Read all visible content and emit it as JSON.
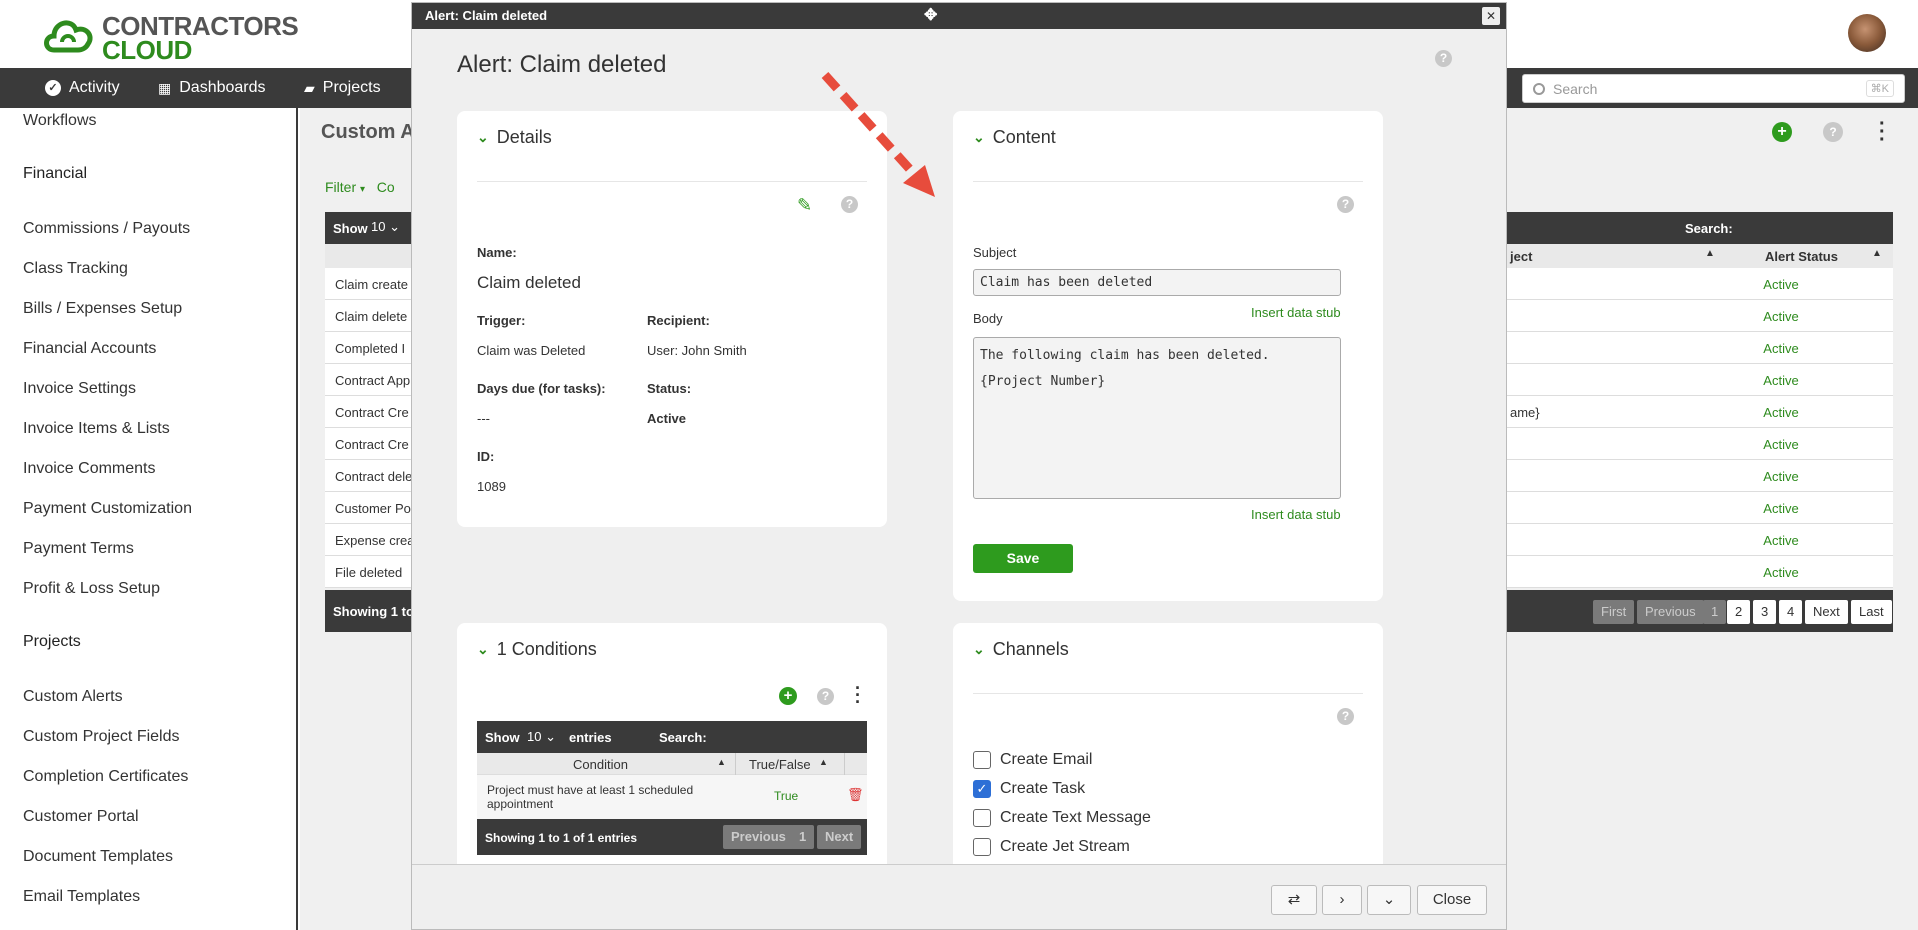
{
  "app": {
    "logo_line1": "CONTRACTORS",
    "logo_line2": "CLOUD",
    "nav": [
      "Activity",
      "Dashboards",
      "Projects"
    ],
    "search_placeholder": "Search",
    "search_shortcut": "⌘K"
  },
  "sidebar": {
    "items": [
      {
        "label": "Workflows",
        "heading": false
      },
      {
        "label": "Financial",
        "heading": true
      },
      {
        "label": "Commissions / Payouts",
        "heading": false
      },
      {
        "label": "Class Tracking",
        "heading": false
      },
      {
        "label": "Bills / Expenses Setup",
        "heading": false
      },
      {
        "label": "Financial Accounts",
        "heading": false
      },
      {
        "label": "Invoice Settings",
        "heading": false
      },
      {
        "label": "Invoice Items & Lists",
        "heading": false
      },
      {
        "label": "Invoice Comments",
        "heading": false
      },
      {
        "label": "Payment Customization",
        "heading": false
      },
      {
        "label": "Payment Terms",
        "heading": false
      },
      {
        "label": "Profit & Loss Setup",
        "heading": false
      },
      {
        "label": "Projects",
        "heading": true
      },
      {
        "label": "Custom Alerts",
        "heading": false
      },
      {
        "label": "Custom Project Fields",
        "heading": false
      },
      {
        "label": "Completion Certificates",
        "heading": false
      },
      {
        "label": "Customer Portal",
        "heading": false
      },
      {
        "label": "Document Templates",
        "heading": false
      },
      {
        "label": "Email Templates",
        "heading": false
      }
    ]
  },
  "background_page": {
    "title": "Custom A",
    "filter": "Filter",
    "filter2": "Co",
    "show_label": "Show",
    "show_value": "10",
    "search_label": "Search:",
    "col_project": "ject",
    "col_status": "Alert Status",
    "rows": [
      {
        "name": "Claim create",
        "extra": "",
        "status": "Active"
      },
      {
        "name": "Claim delete",
        "extra": "",
        "status": "Active"
      },
      {
        "name": "Completed I",
        "extra": "",
        "status": "Active"
      },
      {
        "name": "Contract App",
        "extra": "",
        "status": "Active"
      },
      {
        "name": "Contract Cre",
        "extra": "ame}",
        "status": "Active"
      },
      {
        "name": "Contract Cre",
        "extra": "",
        "status": "Active"
      },
      {
        "name": "Contract dele",
        "extra": "",
        "status": "Active"
      },
      {
        "name": "Customer Po",
        "extra": "",
        "status": "Active"
      },
      {
        "name": "Expense crea",
        "extra": "",
        "status": "Active"
      },
      {
        "name": "File deleted",
        "extra": "",
        "status": "Active"
      }
    ],
    "showing": "Showing 1 to",
    "pagination": [
      "First",
      "Previous",
      "1",
      "2",
      "3",
      "4",
      "Next",
      "Last"
    ]
  },
  "modal": {
    "titlebar": "Alert: Claim deleted",
    "heading": "Alert: Claim deleted",
    "details": {
      "title": "Details",
      "name_label": "Name:",
      "name_value": "Claim deleted",
      "trigger_label": "Trigger:",
      "trigger_value": "Claim was Deleted",
      "recipient_label": "Recipient:",
      "recipient_value": "User: John Smith",
      "days_label": "Days due (for tasks):",
      "days_value": "---",
      "status_label": "Status:",
      "status_value": "Active",
      "id_label": "ID:",
      "id_value": "1089"
    },
    "content": {
      "title": "Content",
      "subject_label": "Subject",
      "subject_value": "Claim has been deleted",
      "insert_stub": "Insert data stub",
      "body_label": "Body",
      "body_value": "The following claim has been deleted. {Project Number}",
      "save": "Save"
    },
    "conditions": {
      "title": "1 Conditions",
      "show_label": "Show",
      "show_value": "10",
      "entries_label": "entries",
      "search_label": "Search:",
      "col_condition": "Condition",
      "col_truefalse": "True/False",
      "rows": [
        {
          "condition": "Project must have at least 1 scheduled appointment",
          "value": "True"
        }
      ],
      "showing": "Showing 1 to 1 of 1 entries",
      "prev": "Previous",
      "page": "1",
      "next": "Next"
    },
    "channels": {
      "title": "Channels",
      "items": [
        {
          "label": "Create Email",
          "checked": false
        },
        {
          "label": "Create Task",
          "checked": true
        },
        {
          "label": "Create Text Message",
          "checked": false
        },
        {
          "label": "Create Jet Stream",
          "checked": false
        }
      ]
    },
    "footer": {
      "close": "Close"
    }
  },
  "colors": {
    "accent_green": "#2e8b1e",
    "dark_bar": "#3a3a3a",
    "arrow_red": "#e74c3c",
    "checkbox_blue": "#2d6fd6"
  }
}
